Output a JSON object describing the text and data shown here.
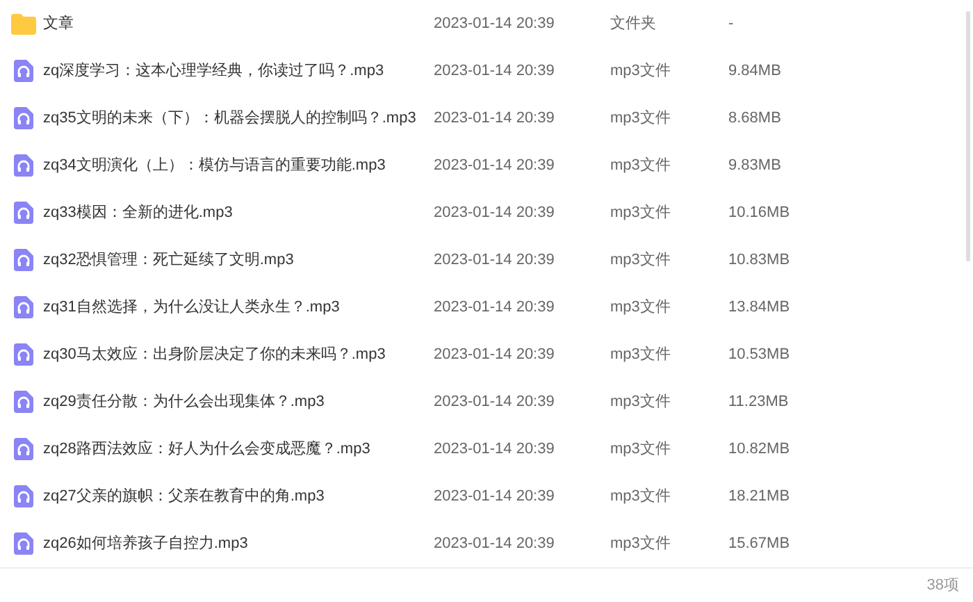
{
  "files": [
    {
      "kind": "folder",
      "name": "文章",
      "date": "2023-01-14 20:39",
      "type": "文件夹",
      "size": "-"
    },
    {
      "kind": "audio",
      "name": "zq深度学习：这本心理学经典，你读过了吗？.mp3",
      "date": "2023-01-14 20:39",
      "type": "mp3文件",
      "size": "9.84MB"
    },
    {
      "kind": "audio",
      "name": "zq35文明的未来（下）：机器会摆脱人的控制吗？.mp3",
      "date": "2023-01-14 20:39",
      "type": "mp3文件",
      "size": "8.68MB"
    },
    {
      "kind": "audio",
      "name": "zq34文明演化（上）：模仿与语言的重要功能.mp3",
      "date": "2023-01-14 20:39",
      "type": "mp3文件",
      "size": "9.83MB"
    },
    {
      "kind": "audio",
      "name": "zq33模因：全新的进化.mp3",
      "date": "2023-01-14 20:39",
      "type": "mp3文件",
      "size": "10.16MB"
    },
    {
      "kind": "audio",
      "name": "zq32恐惧管理：死亡延续了文明.mp3",
      "date": "2023-01-14 20:39",
      "type": "mp3文件",
      "size": "10.83MB"
    },
    {
      "kind": "audio",
      "name": "zq31自然选择，为什么没让人类永生？.mp3",
      "date": "2023-01-14 20:39",
      "type": "mp3文件",
      "size": "13.84MB"
    },
    {
      "kind": "audio",
      "name": "zq30马太效应：出身阶层决定了你的未来吗？.mp3",
      "date": "2023-01-14 20:39",
      "type": "mp3文件",
      "size": "10.53MB"
    },
    {
      "kind": "audio",
      "name": "zq29责任分散：为什么会出现集体？.mp3",
      "date": "2023-01-14 20:39",
      "type": "mp3文件",
      "size": "11.23MB"
    },
    {
      "kind": "audio",
      "name": "zq28路西法效应：好人为什么会变成恶魔？.mp3",
      "date": "2023-01-14 20:39",
      "type": "mp3文件",
      "size": "10.82MB"
    },
    {
      "kind": "audio",
      "name": "zq27父亲的旗帜：父亲在教育中的角.mp3",
      "date": "2023-01-14 20:39",
      "type": "mp3文件",
      "size": "18.21MB"
    },
    {
      "kind": "audio",
      "name": "zq26如何培养孩子自控力.mp3",
      "date": "2023-01-14 20:39",
      "type": "mp3文件",
      "size": "15.67MB"
    }
  ],
  "status_bar": {
    "count": "38项"
  }
}
